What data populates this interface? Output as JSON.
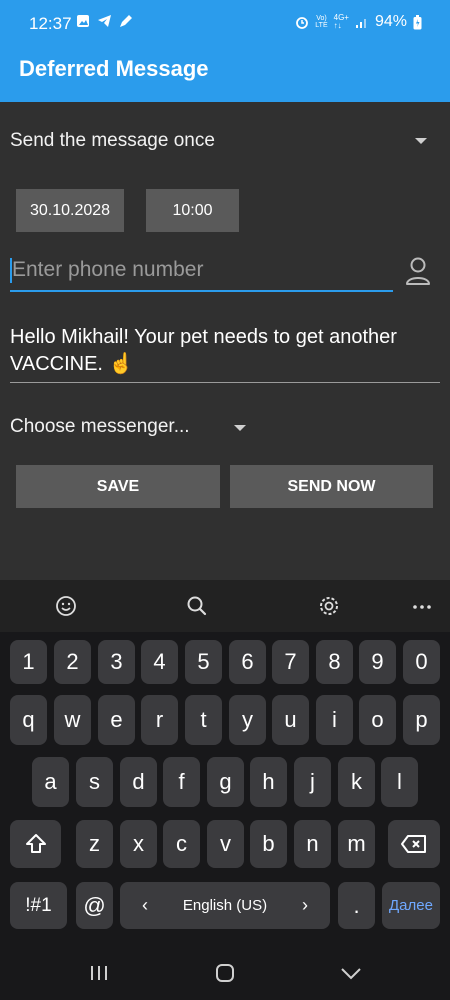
{
  "status_bar": {
    "time": "12:37",
    "left_icons": [
      "image-icon",
      "telegram-icon",
      "rocket-icon"
    ],
    "right_icons": [
      "alarm-icon",
      "volte-icon",
      "signal-4g-icon",
      "signal-bars-icon"
    ],
    "battery": "94%"
  },
  "app_bar": {
    "title": "Deferred Message"
  },
  "form": {
    "frequency": "Send the message once",
    "date": "30.10.2028",
    "time": "10:00",
    "phone_placeholder": "Enter phone number",
    "phone_value": "",
    "message": "Hello Mikhail! Your pet needs to get another VACCINE. ☝️",
    "messenger": "Choose messenger...",
    "save_label": "SAVE",
    "send_now_label": "SEND NOW"
  },
  "keyboard": {
    "toolbar": [
      "emoji-icon",
      "search-icon",
      "settings-icon",
      "more-icon"
    ],
    "rows": [
      [
        "1",
        "2",
        "3",
        "4",
        "5",
        "6",
        "7",
        "8",
        "9",
        "0"
      ],
      [
        "q",
        "w",
        "e",
        "r",
        "t",
        "y",
        "u",
        "i",
        "o",
        "p"
      ],
      [
        "a",
        "s",
        "d",
        "f",
        "g",
        "h",
        "j",
        "k",
        "l"
      ],
      [
        "z",
        "x",
        "c",
        "v",
        "b",
        "n",
        "m"
      ]
    ],
    "symbols_label": "!#1",
    "at_label": "@",
    "language_label": "English (US)",
    "period_label": ".",
    "enter_label": "Далее",
    "accent_color": "#6fa8ff"
  },
  "nav_bar": {
    "icons": [
      "recents-icon",
      "home-icon",
      "back-icon"
    ]
  },
  "colors": {
    "primary": "#2b9cec",
    "background": "#303030",
    "button": "#5a5a5a"
  }
}
